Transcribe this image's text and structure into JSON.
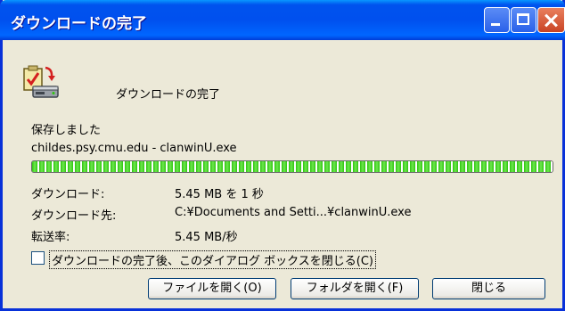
{
  "window": {
    "title": "ダウンロードの完了"
  },
  "header": {
    "label": "ダウンロードの完了"
  },
  "status": {
    "saved": "保存しました",
    "file": "childes.psy.cmu.edu - clanwinU.exe"
  },
  "progress": {
    "percent": 100
  },
  "details": [
    {
      "key": "ダウンロード:",
      "value": "5.45 MB を 1 秒"
    },
    {
      "key": "ダウンロード先:",
      "value": "C:¥Documents and Setti...¥clanwinU.exe"
    },
    {
      "key": "転送率:",
      "value": "5.45 MB/秒"
    }
  ],
  "checkbox": {
    "label": "ダウンロードの完了後、このダイアログ ボックスを閉じる(C)",
    "checked": false
  },
  "buttons": {
    "open": "ファイルを開く(O)",
    "folder": "フォルダを開く(F)",
    "close": "閉じる"
  },
  "icons": {
    "download": "download-complete-icon"
  },
  "colors": {
    "titlebar": "#0054e3",
    "progress": "#2ec40e",
    "background": "#ece9d8"
  }
}
